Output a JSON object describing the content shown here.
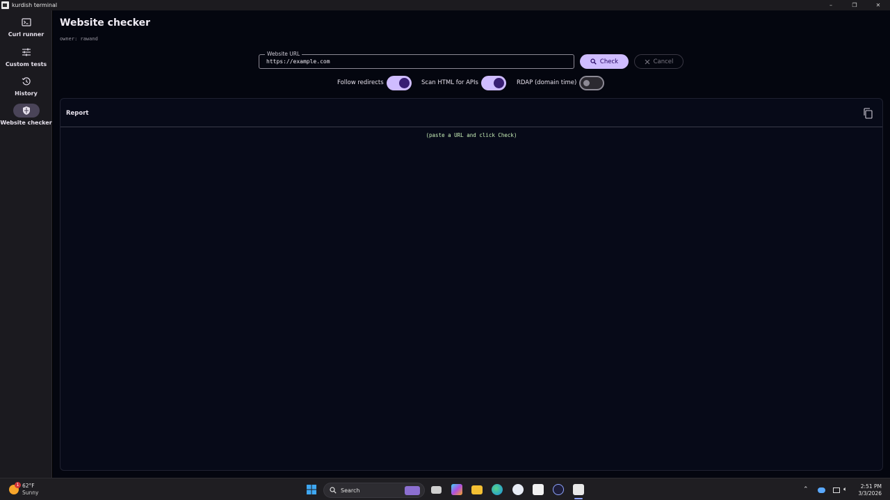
{
  "window": {
    "title": "kurdish terminal",
    "controls": [
      "–",
      "❐",
      "✕"
    ]
  },
  "sidebar": {
    "items": [
      {
        "label": "Curl runner",
        "icon": "terminal-icon"
      },
      {
        "label": "Custom tests",
        "icon": "tune-icon"
      },
      {
        "label": "History",
        "icon": "history-icon"
      },
      {
        "label": "Website checker",
        "icon": "shield-icon",
        "active": true
      }
    ]
  },
  "main": {
    "title": "Website checker",
    "owner": "owner: rawand",
    "url_field": {
      "legend": "Website URL",
      "value": "https://example.com"
    },
    "check_button": "Check",
    "cancel_button": "Cancel",
    "toggles": [
      {
        "label": "Follow redirects",
        "on": true
      },
      {
        "label": "Scan HTML for APIs",
        "on": true
      },
      {
        "label": "RDAP (domain time)",
        "on": false
      }
    ],
    "report": {
      "title": "Report",
      "placeholder": "(paste a URL and click Check)"
    }
  },
  "taskbar": {
    "weather": {
      "temp": "62°F",
      "condition": "Sunny",
      "badge": "1"
    },
    "search_label": "Search",
    "time": "2:51 PM",
    "date": "3/3/2026"
  },
  "colors": {
    "accent": "#cfbcff",
    "accent_on": "#381e72",
    "background": "#04060f",
    "sidebar": "#1b1a1f"
  }
}
